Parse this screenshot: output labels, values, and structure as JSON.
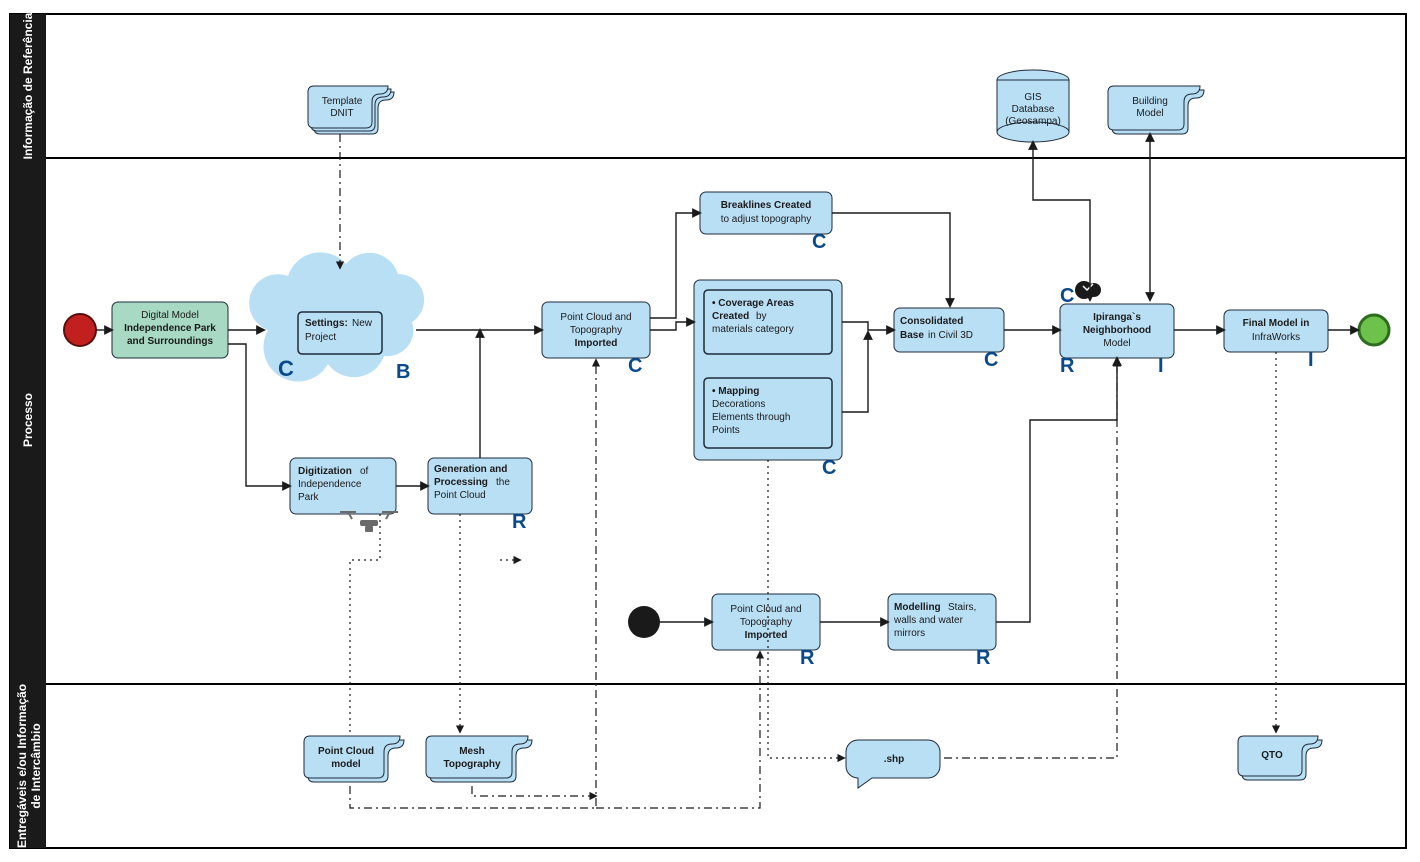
{
  "lanes": {
    "ref": "Informação de Referência",
    "proc": "Processo",
    "deliv": "Entregáveis e/ou Informação de Intercâmbio"
  },
  "refs": {
    "template": "Template DNIT",
    "gis_l1": "GIS",
    "gis_l2": "Database",
    "gis_l3": "(Geosampa)",
    "building": "Building Model"
  },
  "nodes": {
    "digital_l1": "Digital Model",
    "digital_l2": "Independence Park",
    "digital_l3": "and Surroundings",
    "settings_l1": "Settings:",
    "settings_l2": "New",
    "settings_l3": "Project",
    "digi_l1": "Digitization",
    "digi_l2": "of",
    "digi_l3": "Independence",
    "digi_l4": "Park",
    "gen_l1": "Generation and",
    "gen_l2": "Processing",
    "gen_l3": "the",
    "gen_l4": "Point Cloud",
    "pc_topo_l1": "Point Cloud and",
    "pc_topo_l2": "Topography",
    "pc_topo_l3": "Imported",
    "break_l1": "Breaklines Created",
    "break_l2": "to adjust topography",
    "cov_l1": "• Coverage Areas",
    "cov_l2": "Created",
    "cov_l3": "by",
    "cov_l4": "materials category",
    "map_l1": "• Mapping",
    "map_l2": "Decorations",
    "map_l3": "Elements through",
    "map_l4": "Points",
    "cons_l1": "Consolidated",
    "cons_l2": "Base",
    "cons_l3": "in Civil 3D",
    "neigh_l1": "Ipiranga`s",
    "neigh_l2": "Neighborhood",
    "neigh_l3": "Model",
    "final_l1": "Final Model in",
    "final_l2": "InfraWorks",
    "pc_topo2_l1": "Point Cloud and",
    "pc_topo2_l2": "Topography",
    "pc_topo2_l3": "Imported",
    "model_l1": "Modelling",
    "model_l2": "Stairs,",
    "model_l3": "walls and water",
    "model_l4": "mirrors"
  },
  "deliv": {
    "pcm": "Point Cloud model",
    "mesh": "Mesh Topography",
    "shp": ".shp",
    "qto": "QTO"
  },
  "icons": {
    "C": "C",
    "B": "B",
    "R": "R",
    "I": "I"
  }
}
